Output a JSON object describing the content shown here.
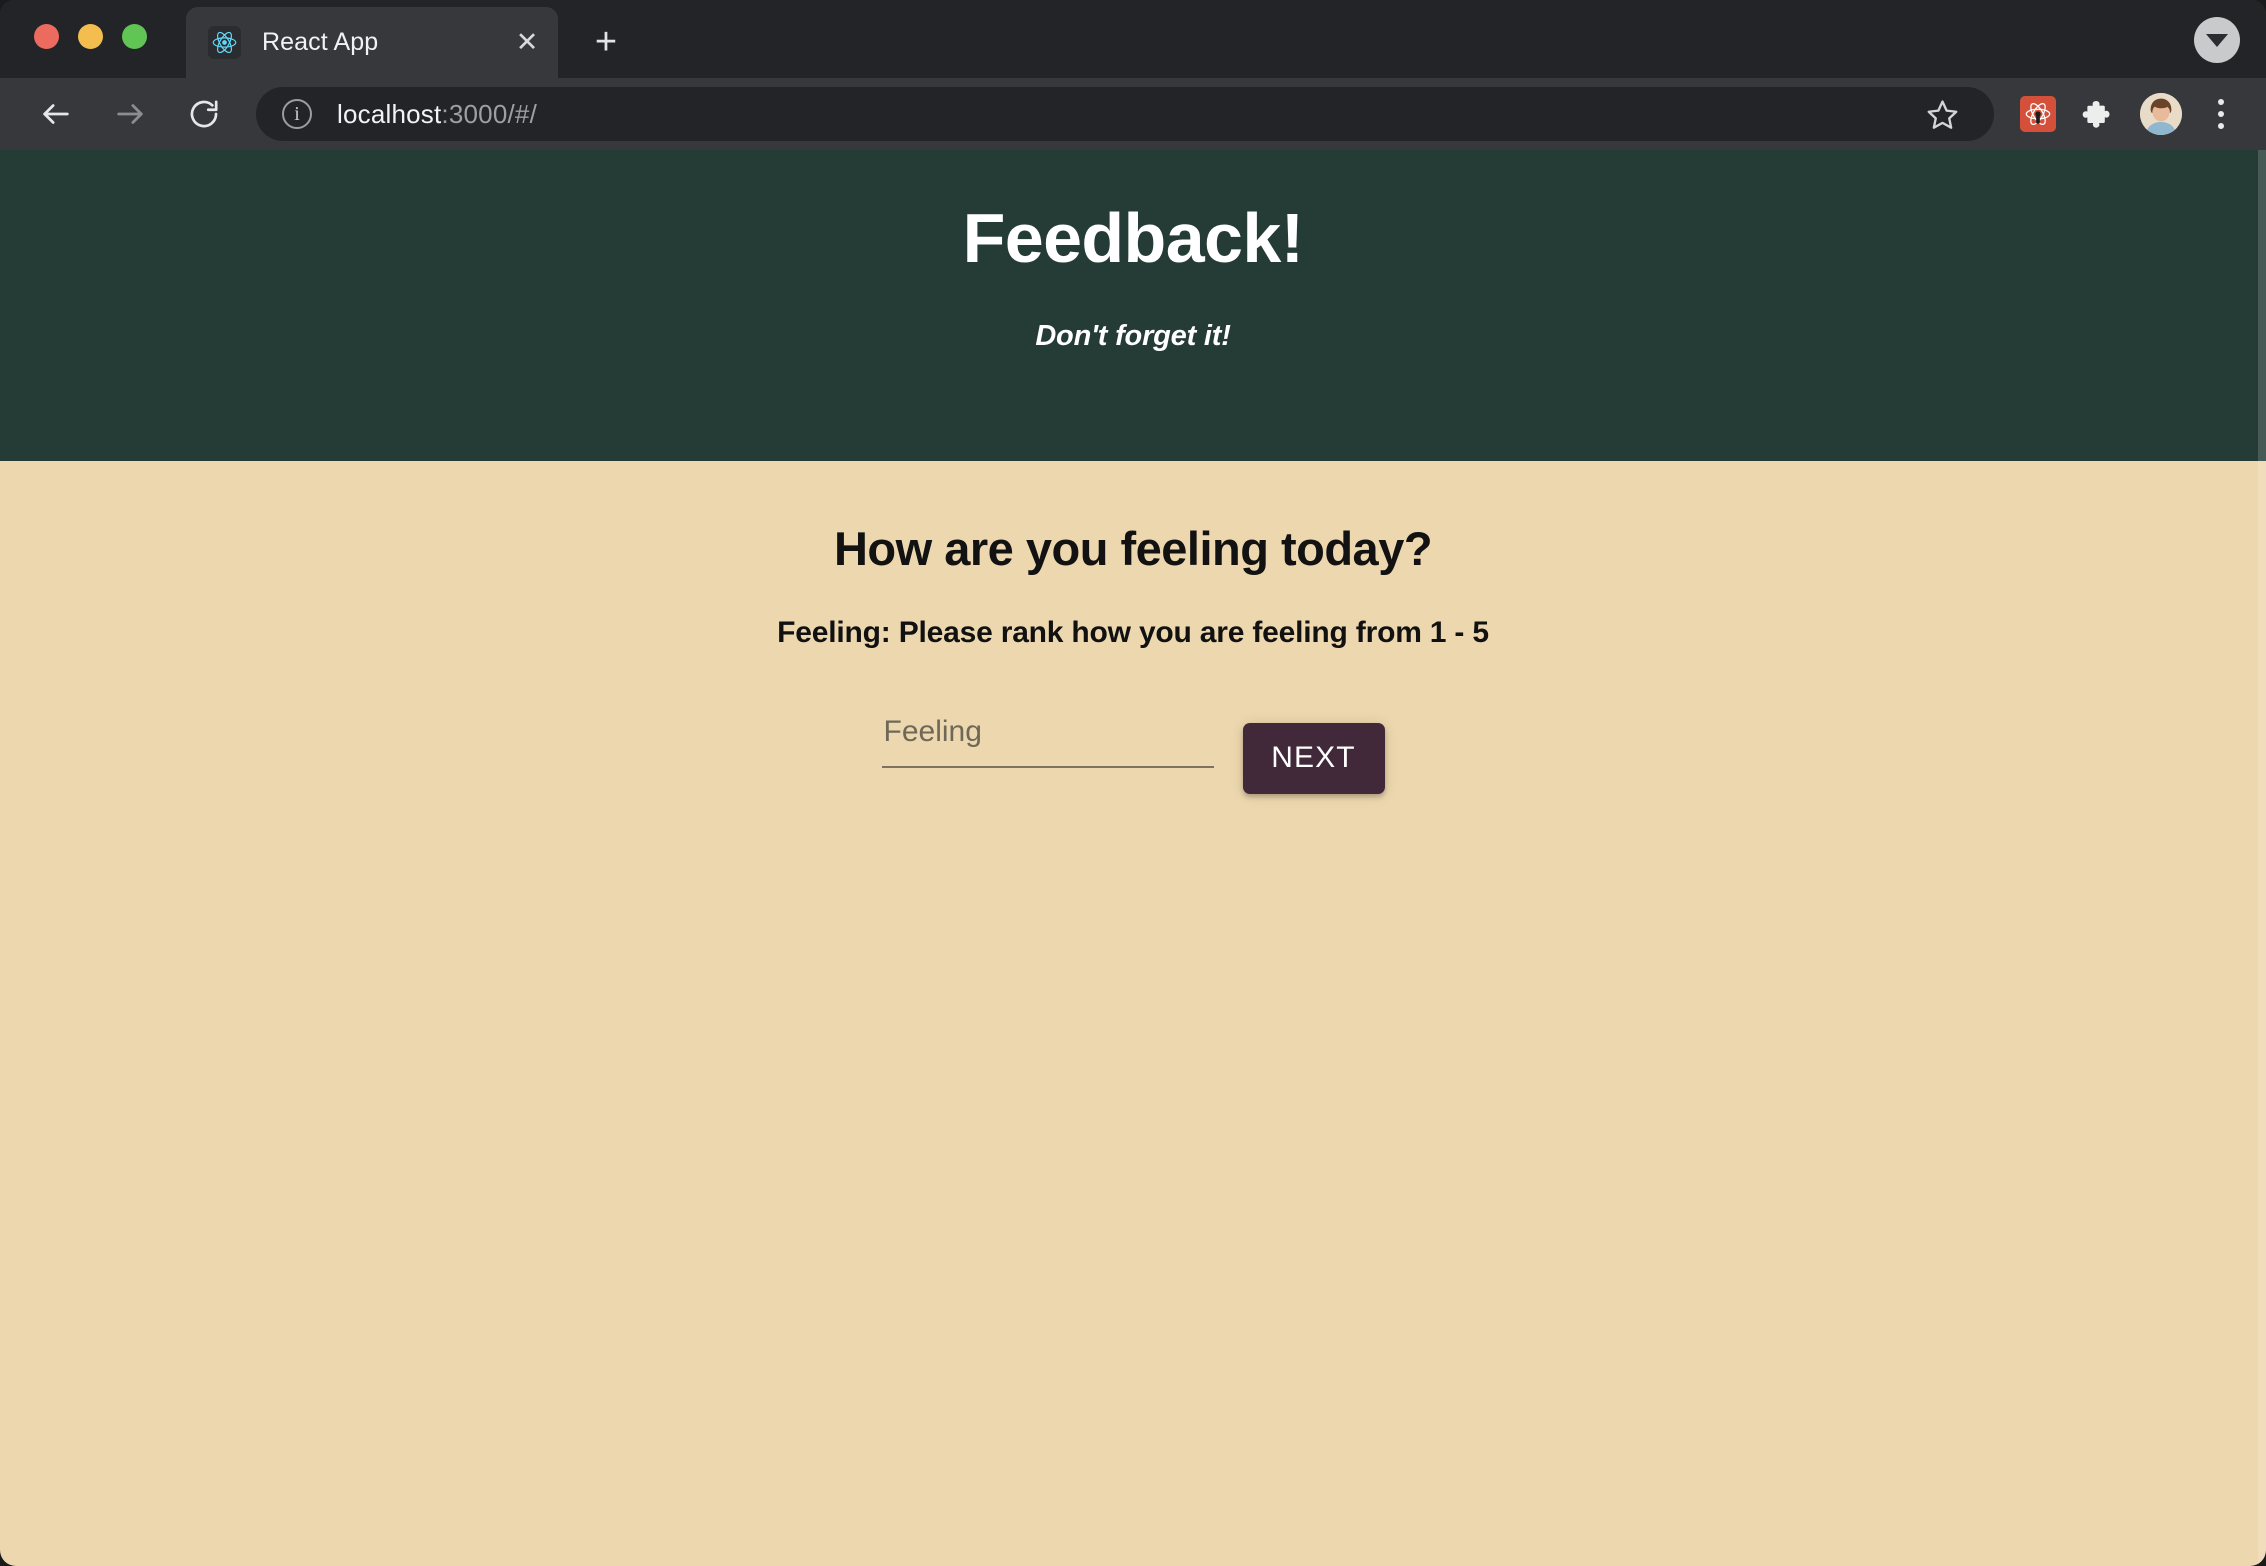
{
  "browser": {
    "traffic_lights": [
      {
        "name": "close",
        "color": "#ED6A5E"
      },
      {
        "name": "minimize",
        "color": "#F4BE4F"
      },
      {
        "name": "maximize",
        "color": "#61C555"
      }
    ],
    "tab": {
      "title": "React App",
      "favicon": "react-logo-icon",
      "close_label": "✕"
    },
    "new_tab_label": "+",
    "tab_list_chevron": "chevron-down-icon",
    "toolbar": {
      "back_icon": "arrow-left-icon",
      "forward_icon": "arrow-right-icon",
      "reload_icon": "reload-icon",
      "site_info_icon": "info-circle-icon",
      "url_primary": "localhost",
      "url_secondary": ":3000/#/",
      "url_full": "localhost:3000/#/",
      "bookmark_icon": "star-outline-icon",
      "extension_react_devtools": "react-devtools-icon",
      "extension_puzzle": "extensions-puzzle-icon",
      "profile_avatar": "user-avatar",
      "menu_icon": "three-dot-menu-icon"
    }
  },
  "app": {
    "header": {
      "title": "Feedback!",
      "subtitle": "Don't forget it!",
      "background_color": "#243B36",
      "text_color": "#FFFFFF"
    },
    "body": {
      "background_color": "#EDD7AE",
      "heading": "How are you feeling today?",
      "prompt": "Feeling: Please rank how you are feeling from 1 - 5",
      "form": {
        "feeling_input": {
          "placeholder": "Feeling",
          "value": ""
        },
        "next_button": {
          "label": "NEXT",
          "background_color": "#42293A",
          "text_color": "#FFFFFF"
        }
      }
    }
  }
}
